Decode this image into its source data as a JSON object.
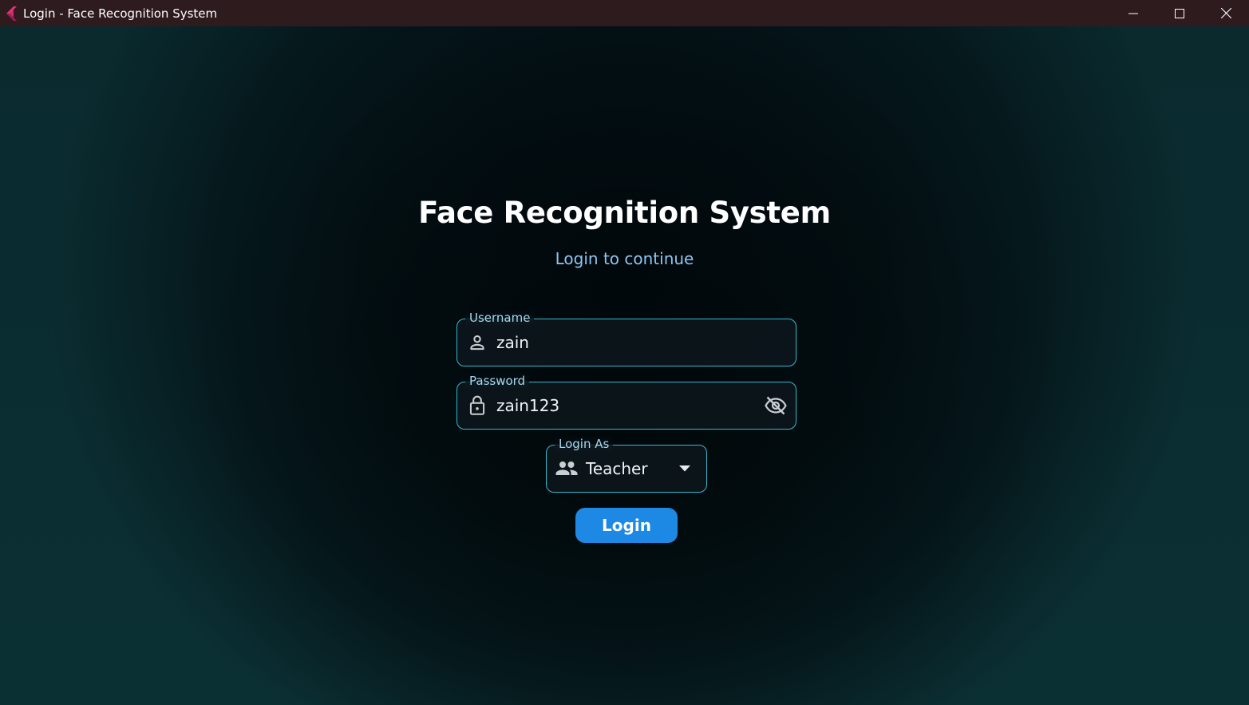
{
  "window": {
    "title": "Login - Face Recognition System",
    "app_icon": "flutter-logo-icon",
    "controls": [
      "minimize-icon",
      "maximize-icon",
      "close-icon"
    ]
  },
  "login": {
    "heading": "Face Recognition System",
    "subheading": "Login to continue",
    "username": {
      "label": "Username",
      "value": "zain",
      "icon": "person-icon"
    },
    "password": {
      "label": "Password",
      "value": "zain123",
      "icon": "lock-icon",
      "visibility_icon": "visibility-off-icon"
    },
    "role": {
      "label": "Login As",
      "selected": "Teacher",
      "icon": "people-icon",
      "dropdown_icon": "arrow-drop-down-icon"
    },
    "submit_label": "Login"
  },
  "colors": {
    "titlebar": "#2d1b1e",
    "field_border": "#35b9cf",
    "accent_button": "#1e88e5",
    "subheading": "#8ec5f0"
  }
}
